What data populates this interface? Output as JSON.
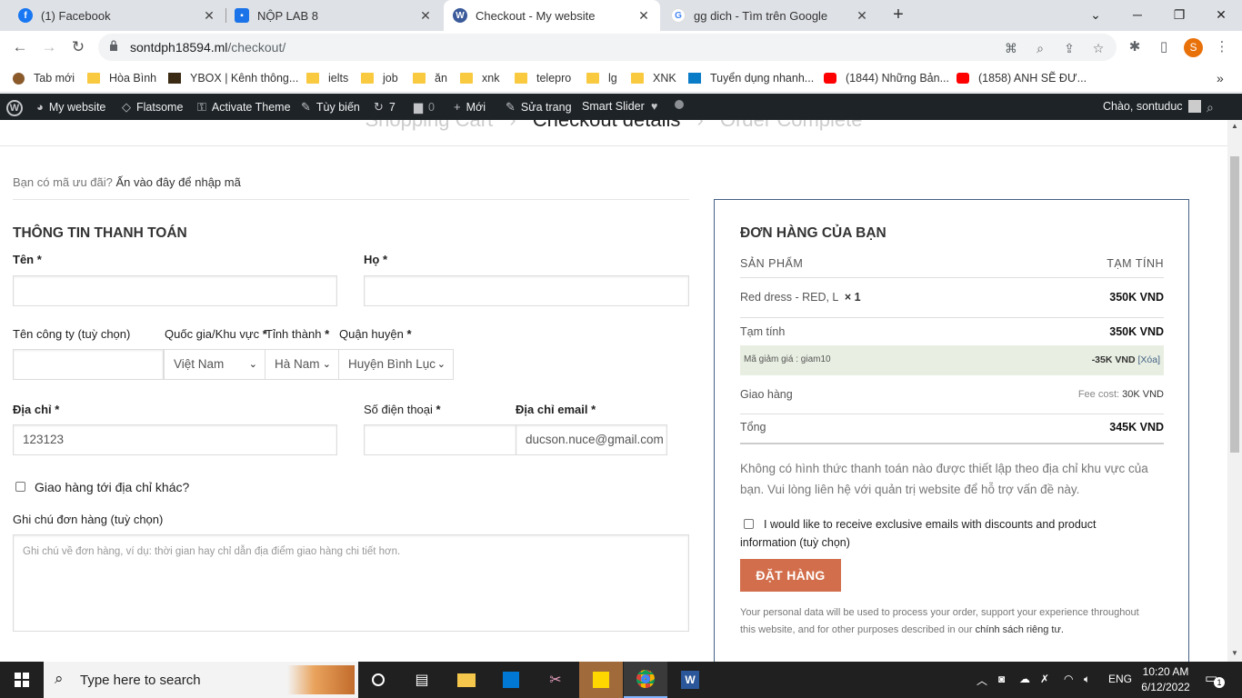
{
  "browser": {
    "tabs": [
      {
        "title": "(1) Facebook",
        "icon": "facebook-icon",
        "color": "#1877f2"
      },
      {
        "title": "NỘP LAB 8",
        "icon": "classroom-icon",
        "color": "#1a73e8"
      },
      {
        "title": "Checkout - My website",
        "icon": "wordpress-icon",
        "color": "#3b5a9a"
      },
      {
        "title": "gg dich - Tìm trên Google",
        "icon": "google-icon",
        "color": "#4285f4"
      }
    ],
    "url_host": "sontdph18594.ml",
    "url_path": "/checkout/",
    "profile_initial": "S",
    "bookmarks": [
      "Tab mới",
      "Hòa Bình",
      "YBOX | Kênh thông...",
      "ielts",
      "job",
      "ăn",
      "xnk",
      "telepro",
      "lg",
      "XNK",
      "Tuyển dụng nhanh...",
      "(1844) Những Bản...",
      "(1858) ANH SẼ ĐƯ..."
    ]
  },
  "adminbar": {
    "site": "My website",
    "theme": "Flatsome",
    "activate": "Activate Theme",
    "customize": "Tùy biến",
    "updates": "7",
    "comments": "0",
    "new": "Mới",
    "edit": "Sửa trang",
    "slider": "Smart Slider",
    "greeting": "Chào, sontuduc"
  },
  "checkout": {
    "steps": [
      "Shopping Cart",
      "Checkout details",
      "Order Complete"
    ],
    "coupon_text": "Bạn có mã ưu đãi?",
    "coupon_link": "Ấn vào đây để nhập mã",
    "billing_title": "THÔNG TIN THANH TOÁN",
    "first_name_label": "Tên",
    "last_name_label": "Họ",
    "company_label": "Tên công ty (tuỳ chọn)",
    "country_label": "Quốc gia/Khu vực",
    "province_label": "Tỉnh thành",
    "district_label": "Quận huyện",
    "country_value": "Việt Nam",
    "province_value": "Hà Nam",
    "district_value": "Huyện Bình Lục",
    "address_label": "Địa chỉ",
    "address_value": "123123",
    "phone_label": "Số điện thoại",
    "email_label": "Địa chỉ email",
    "email_value": "ducson.nuce@gmail.com",
    "ship_other_label": "Giao hàng tới địa chỉ khác?",
    "notes_label": "Ghi chú đơn hàng (tuỳ chọn)",
    "notes_placeholder": "Ghi chú về đơn hàng, ví dụ: thời gian hay chỉ dẫn địa điểm giao hàng chi tiết hơn.",
    "required": "*"
  },
  "order": {
    "title": "ĐƠN HÀNG CỦA BẠN",
    "col_product": "SẢN PHẨM",
    "col_subtotal": "TẠM TÍNH",
    "item_name": "Red dress - RED, L",
    "item_qty": "× 1",
    "item_price": "350K VND",
    "subtotal_label": "Tạm tính",
    "subtotal_value": "350K VND",
    "coupon_label": "Mã giảm giá : giam10",
    "coupon_value": "-35K VND",
    "coupon_remove": "[Xóa]",
    "shipping_label": "Giao hàng",
    "shipping_fee_label": "Fee cost:",
    "shipping_fee": "30K VND",
    "total_label": "Tổng",
    "total_value": "345K VND",
    "no_payment": "Không có hình thức thanh toán nào được thiết lập theo địa chỉ khu vực của bạn. Vui lòng liên hệ với quản trị website để hỗ trợ vấn đề này.",
    "newsletter": "I would like to receive exclusive emails with discounts and product information (tuỳ chọn)",
    "button": "ĐẶT HÀNG",
    "privacy": "Your personal data will be used to process your order, support your experience throughout this website, and for other purposes described in our",
    "privacy_link": "chính sách riêng tư."
  },
  "taskbar": {
    "search_placeholder": "Type here to search",
    "lang": "ENG",
    "time": "10:20 AM",
    "date": "6/12/2022",
    "notif_count": "1"
  }
}
